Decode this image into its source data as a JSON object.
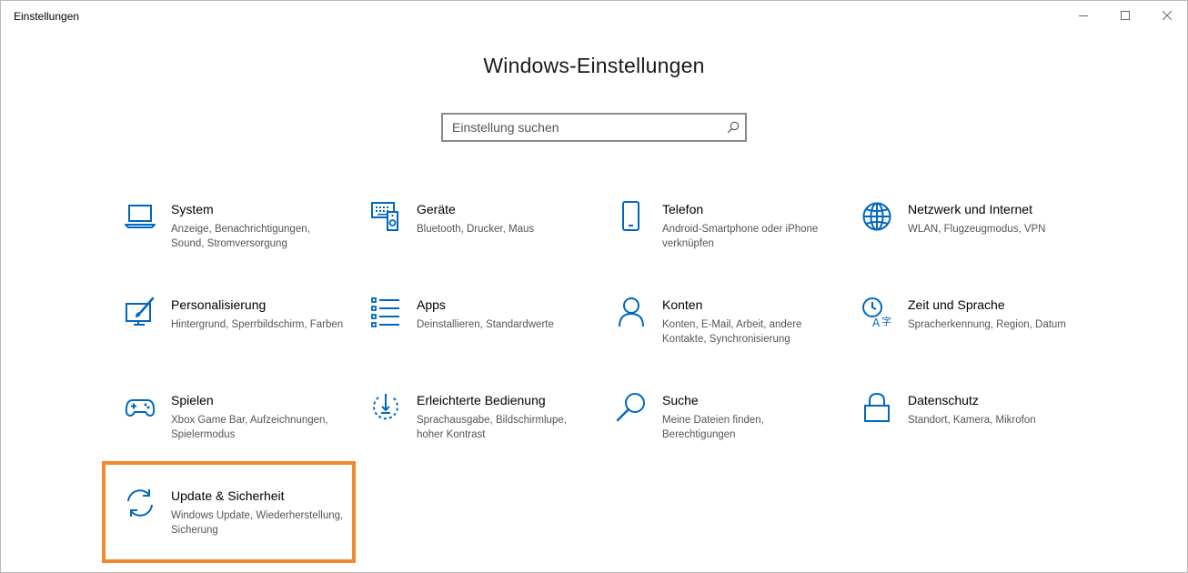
{
  "window": {
    "title": "Einstellungen",
    "controls": [
      "minimize-icon",
      "maximize-icon",
      "close-icon"
    ]
  },
  "page": {
    "title": "Windows-Einstellungen"
  },
  "search": {
    "placeholder": "Einstellung suchen",
    "value": "",
    "icon": "search-icon"
  },
  "colors": {
    "accent": "#0067c0",
    "highlight": "#f08a30",
    "description_text": "#555555"
  },
  "tiles": [
    {
      "title": "System",
      "description": "Anzeige, Benachrichtigungen, Sound, Stromversorgung",
      "icon": "laptop-icon"
    },
    {
      "title": "Geräte",
      "description": "Bluetooth, Drucker, Maus",
      "icon": "devices-icon"
    },
    {
      "title": "Telefon",
      "description": "Android-Smartphone oder iPhone verknüpfen",
      "icon": "phone-icon"
    },
    {
      "title": "Netzwerk und Internet",
      "description": "WLAN, Flugzeugmodus, VPN",
      "icon": "globe-icon"
    },
    {
      "title": "Personalisierung",
      "description": "Hintergrund, Sperrbildschirm, Farben",
      "icon": "paintbrush-icon"
    },
    {
      "title": "Apps",
      "description": "Deinstallieren, Standardwerte",
      "icon": "apps-list-icon"
    },
    {
      "title": "Konten",
      "description": "Konten, E-Mail, Arbeit, andere Kontakte, Synchronisierung",
      "icon": "person-icon"
    },
    {
      "title": "Zeit und Sprache",
      "description": "Spracherkennung, Region, Datum",
      "icon": "time-language-icon"
    },
    {
      "title": "Spielen",
      "description": "Xbox Game Bar, Aufzeichnungen, Spielermodus",
      "icon": "gamepad-icon"
    },
    {
      "title": "Erleichterte Bedienung",
      "description": "Sprachausgabe, Bildschirmlupe, hoher Kontrast",
      "icon": "ease-of-access-icon"
    },
    {
      "title": "Suche",
      "description": "Meine Dateien finden, Berechtigungen",
      "icon": "magnifier-icon"
    },
    {
      "title": "Datenschutz",
      "description": "Standort, Kamera, Mikrofon",
      "icon": "lock-icon"
    },
    {
      "title": "Update & Sicherheit",
      "description": "Windows Update, Wiederherstellung, Sicherung",
      "icon": "sync-icon",
      "highlighted": true
    }
  ]
}
